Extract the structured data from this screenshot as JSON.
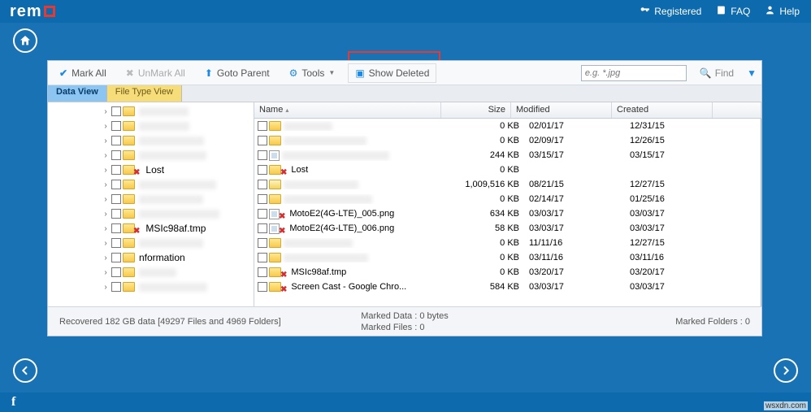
{
  "brand": "rem",
  "top": {
    "registered": "Registered",
    "faq": "FAQ",
    "help": "Help"
  },
  "toolbar": {
    "mark_all": "Mark All",
    "unmark_all": "UnMark All",
    "goto_parent": "Goto Parent",
    "tools": "Tools",
    "show_deleted": "Show Deleted",
    "search_placeholder": "e.g. *.jpg",
    "find": "Find"
  },
  "tabs": {
    "data_view": "Data View",
    "file_type_view": "File Type View"
  },
  "columns": {
    "name": "Name",
    "size": "Size",
    "modified": "Modified",
    "created": "Created"
  },
  "tree": [
    {
      "indent": 2,
      "label": "",
      "deleted": false
    },
    {
      "indent": 2,
      "label": "",
      "deleted": false
    },
    {
      "indent": 2,
      "label": "",
      "deleted": false
    },
    {
      "indent": 2,
      "label": "",
      "deleted": false
    },
    {
      "indent": 2,
      "label": "Lost",
      "deleted": true
    },
    {
      "indent": 2,
      "label": "",
      "deleted": false
    },
    {
      "indent": 2,
      "label": "",
      "deleted": false
    },
    {
      "indent": 2,
      "label": "",
      "deleted": false
    },
    {
      "indent": 2,
      "label": "MSIc98af.tmp",
      "deleted": true
    },
    {
      "indent": 2,
      "label": "",
      "deleted": false
    },
    {
      "indent": 2,
      "label": "nformation",
      "deleted": false,
      "partial": true
    },
    {
      "indent": 2,
      "label": "",
      "deleted": false
    },
    {
      "indent": 2,
      "label": "",
      "deleted": false
    }
  ],
  "rows": [
    {
      "name": "",
      "icon": "folder",
      "deleted": false,
      "size": "0 KB",
      "modified": "02/01/17",
      "created": "12/31/15"
    },
    {
      "name": "",
      "icon": "folder",
      "deleted": false,
      "size": "0 KB",
      "modified": "02/09/17",
      "created": "12/26/15"
    },
    {
      "name": "",
      "icon": "file",
      "deleted": false,
      "size": "244 KB",
      "modified": "03/15/17",
      "created": "03/15/17"
    },
    {
      "name": "Lost",
      "icon": "folder",
      "deleted": true,
      "size": "0 KB",
      "modified": "",
      "created": ""
    },
    {
      "name": "",
      "icon": "zip",
      "deleted": false,
      "size": "1,009,516 KB",
      "modified": "08/21/15",
      "created": "12/27/15"
    },
    {
      "name": "",
      "icon": "folder",
      "deleted": false,
      "size": "0 KB",
      "modified": "02/14/17",
      "created": "01/25/16"
    },
    {
      "name": "MotoE2(4G-LTE)_005.png",
      "icon": "png",
      "deleted": true,
      "size": "634 KB",
      "modified": "03/03/17",
      "created": "03/03/17"
    },
    {
      "name": "MotoE2(4G-LTE)_006.png",
      "icon": "png",
      "deleted": true,
      "size": "58 KB",
      "modified": "03/03/17",
      "created": "03/03/17"
    },
    {
      "name": "",
      "icon": "folder",
      "deleted": false,
      "size": "0 KB",
      "modified": "11/11/16",
      "created": "12/27/15"
    },
    {
      "name": "",
      "icon": "folder",
      "deleted": false,
      "size": "0 KB",
      "modified": "03/11/16",
      "created": "03/11/16"
    },
    {
      "name": "MSIc98af.tmp",
      "icon": "folder",
      "deleted": true,
      "size": "0 KB",
      "modified": "03/20/17",
      "created": "03/20/17"
    },
    {
      "name": "Screen Cast - Google Chro...",
      "icon": "folder",
      "deleted": true,
      "size": "584 KB",
      "modified": "03/03/17",
      "created": "03/03/17"
    }
  ],
  "status": {
    "left": "Recovered 182 GB data [49297 Files and 4969 Folders]",
    "mid1": "Marked Data : 0 bytes",
    "mid2": "Marked Files : 0",
    "right": "Marked Folders : 0"
  },
  "watermark": "wsxdn.com"
}
